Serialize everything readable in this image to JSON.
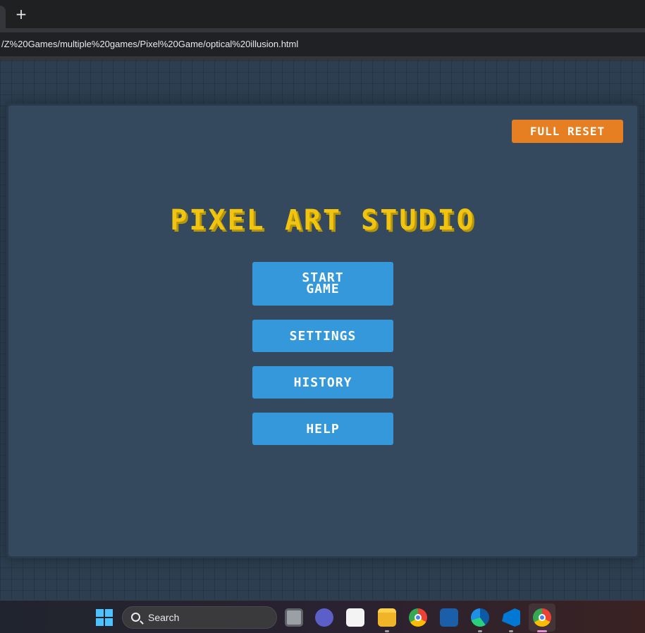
{
  "browser": {
    "new_tab_label": "+",
    "url": "/Z%20Games/multiple%20games/Pixel%20Game/optical%20illusion.html"
  },
  "app": {
    "reset_label": "FULL RESET",
    "title": "PIXEL ART STUDIO",
    "menu": {
      "start_line1": "START",
      "start_line2": "GAME",
      "settings": "SETTINGS",
      "history": "HISTORY",
      "help": "HELP"
    }
  },
  "taskbar": {
    "search_placeholder": "Search",
    "icons": [
      "start-icon",
      "task-view-icon",
      "chat-icon",
      "store-icon",
      "file-explorer-icon",
      "chrome-icon",
      "chess-icon",
      "edge-icon",
      "vscode-icon",
      "chrome-icon"
    ]
  },
  "colors": {
    "title": "#f1c40f",
    "reset_button": "#e67e22",
    "menu_button": "#3498db",
    "panel": "#34495e",
    "page_background": "#2c3e50"
  }
}
